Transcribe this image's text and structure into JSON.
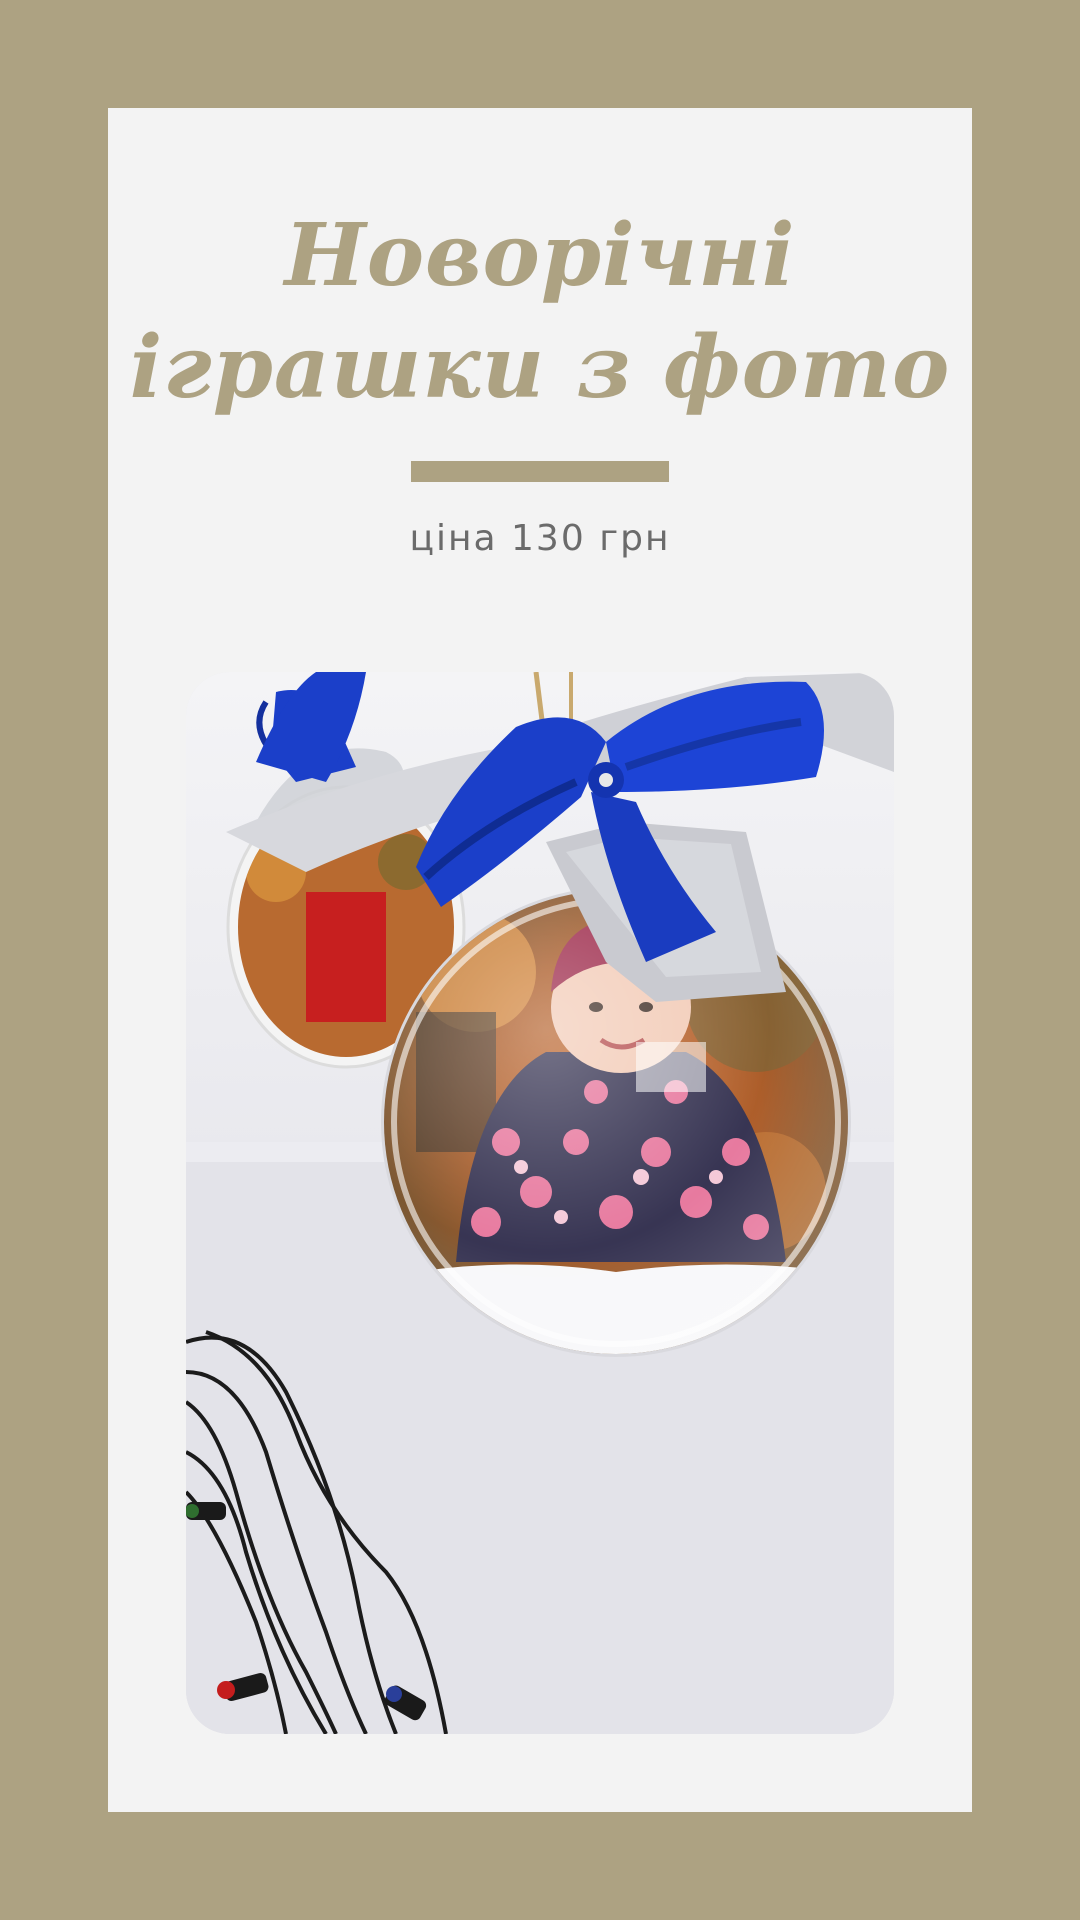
{
  "title": {
    "line1": "Новорічні",
    "line2": "іграшки з фото"
  },
  "price": "ціна 130 грн",
  "photo": {
    "subject": "photo-ornament-with-blue-bow"
  },
  "colors": {
    "background": "#ada282",
    "card": "#f3f3f3",
    "accent": "#ada282",
    "price_text": "#6b6b6b",
    "bow": "#1b3fc9"
  }
}
